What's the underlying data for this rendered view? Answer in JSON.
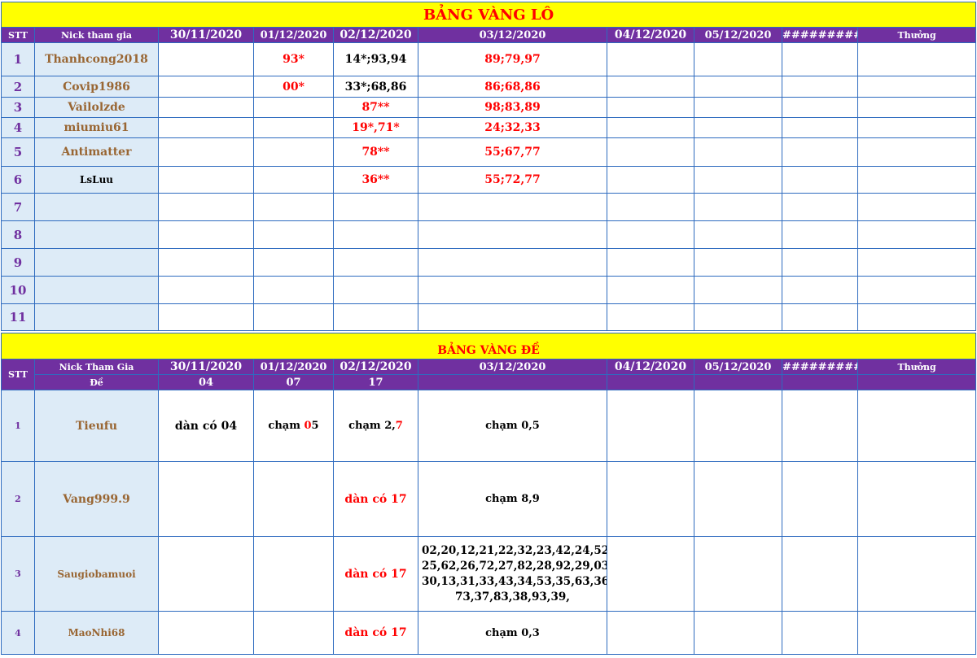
{
  "lo": {
    "title": "BẢNG VÀNG LÔ",
    "headers": {
      "stt": "STT",
      "nick": "Nick tham gia",
      "d1": "30/11/2020",
      "d2": "01/12/2020",
      "d3": "02/12/2020",
      "d4": "03/12/2020",
      "d5": "04/12/2020",
      "d6": "05/12/2020",
      "d7": "#########",
      "reward": "Thưởng"
    },
    "rows": [
      {
        "stt": "1",
        "nick": "Thanhcong2018",
        "d2": "93*",
        "d3": "14*;93,94",
        "d4": "89;79,97"
      },
      {
        "stt": "2",
        "nick": "Covip1986",
        "d2": "00*",
        "d3": "33*;68,86",
        "d4": "86;68,86"
      },
      {
        "stt": "3",
        "nick": "Vailolzde",
        "d3": "87**",
        "d4": "98;83,89"
      },
      {
        "stt": "4",
        "nick": "miumiu61",
        "d3": "19*,71*",
        "d4": "24;32,33"
      },
      {
        "stt": "5",
        "nick": "Antimatter",
        "d3": "78**",
        "d4": "55;67,77"
      },
      {
        "stt": "6",
        "nick": "LsLuu",
        "d3": "36**",
        "d4": "55;72,77"
      },
      {
        "stt": "7"
      },
      {
        "stt": "8"
      },
      {
        "stt": "9"
      },
      {
        "stt": "10"
      },
      {
        "stt": "11"
      }
    ]
  },
  "de": {
    "title": "BẢNG VÀNG ĐỀ",
    "headers": {
      "stt": "STT",
      "nick": "Nick Tham Gia",
      "de": "Đề",
      "d1": "30/11/2020",
      "d2": "01/12/2020",
      "d3": "02/12/2020",
      "d4": "03/12/2020",
      "d5": "04/12/2020",
      "d6": "05/12/2020",
      "d7": "#########",
      "reward": "Thưởng"
    },
    "results": {
      "d1": "04",
      "d2": "07",
      "d3": "17"
    },
    "rows": [
      {
        "stt": "1",
        "nick": "Tieufu",
        "d1": "dàn có 04",
        "d2_pre": "chạm ",
        "d2_hit": "0",
        "d2_post": "5",
        "d3_pre": "chạm 2,",
        "d3_hit": "7",
        "d4": "chạm 0,5"
      },
      {
        "stt": "2",
        "nick": "Vang999.9",
        "d3": "dàn có 17",
        "d4": "chạm 8,9"
      },
      {
        "stt": "3",
        "nick": "Saugiobamuoi",
        "d3": "dàn có 17",
        "d4": "02,20,12,21,22,32,23,42,24,52, 25,62,26,72,27,82,28,92,29,03, 30,13,31,33,43,34,53,35,63,36, 73,37,83,38,93,39,"
      },
      {
        "stt": "4",
        "nick": "MaoNhi68",
        "d3": "dàn có 17",
        "d4": "chạm 0,3"
      }
    ]
  }
}
